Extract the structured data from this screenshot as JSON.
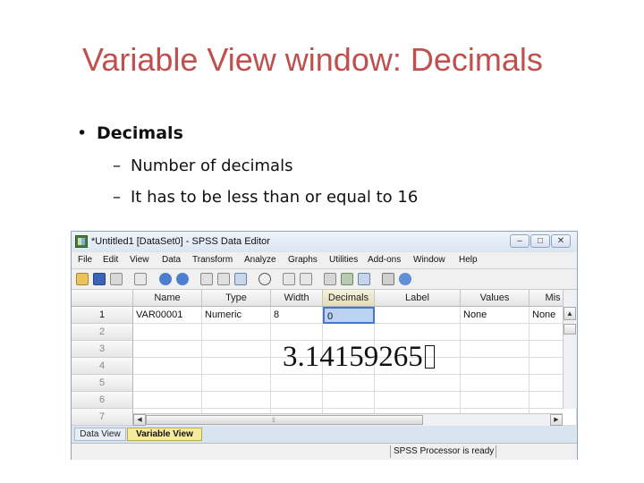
{
  "slide": {
    "title": "Variable View window: Decimals",
    "bullet": "Decimals",
    "subbullets": [
      "Number of decimals",
      "It has to be less than or equal to 16"
    ],
    "bullet_glyph": "•",
    "dash_glyph": "–",
    "overlay_value": "3.14159265"
  },
  "window": {
    "title": "*Untitled1 [DataSet0] - SPSS Data Editor",
    "controls": {
      "minimize": "–",
      "maximize": "□",
      "close": "✕"
    }
  },
  "menu": [
    "File",
    "Edit",
    "View",
    "Data",
    "Transform",
    "Analyze",
    "Graphs",
    "Utilities",
    "Add-ons",
    "Window",
    "Help"
  ],
  "toolbar": [
    "open-folder-icon",
    "save-icon",
    "print-icon",
    "dialog-recall-icon",
    "undo-icon",
    "redo-icon",
    "goto-case-icon",
    "goto-variable-icon",
    "variables-icon",
    "find-icon",
    "insert-cases-icon",
    "insert-variable-icon",
    "split-file-icon",
    "weight-cases-icon",
    "select-cases-icon",
    "value-labels-icon",
    "use-sets-icon"
  ],
  "grid": {
    "columns": [
      "Name",
      "Type",
      "Width",
      "Decimals",
      "Label",
      "Values",
      "Mis"
    ],
    "rows": [
      {
        "num": "1",
        "cells": [
          "VAR00001",
          "Numeric",
          "8",
          "0",
          "",
          "None",
          "None"
        ]
      },
      {
        "num": "2",
        "cells": [
          "",
          "",
          "",
          "",
          "",
          "",
          ""
        ]
      },
      {
        "num": "3",
        "cells": [
          "",
          "",
          "",
          "",
          "",
          "",
          ""
        ]
      },
      {
        "num": "4",
        "cells": [
          "",
          "",
          "",
          "",
          "",
          "",
          ""
        ]
      },
      {
        "num": "5",
        "cells": [
          "",
          "",
          "",
          "",
          "",
          "",
          ""
        ]
      },
      {
        "num": "6",
        "cells": [
          "",
          "",
          "",
          "",
          "",
          "",
          ""
        ]
      },
      {
        "num": "7",
        "cells": [
          "",
          "",
          "",
          "",
          "",
          "",
          ""
        ]
      }
    ]
  },
  "tabs": {
    "data_view": "Data View",
    "variable_view": "Variable View"
  },
  "status": "SPSS  Processor is ready",
  "colors": {
    "title": "#c0504d",
    "active_tab": "#f6e9a0",
    "selected_cell": "#bcd2f2"
  }
}
